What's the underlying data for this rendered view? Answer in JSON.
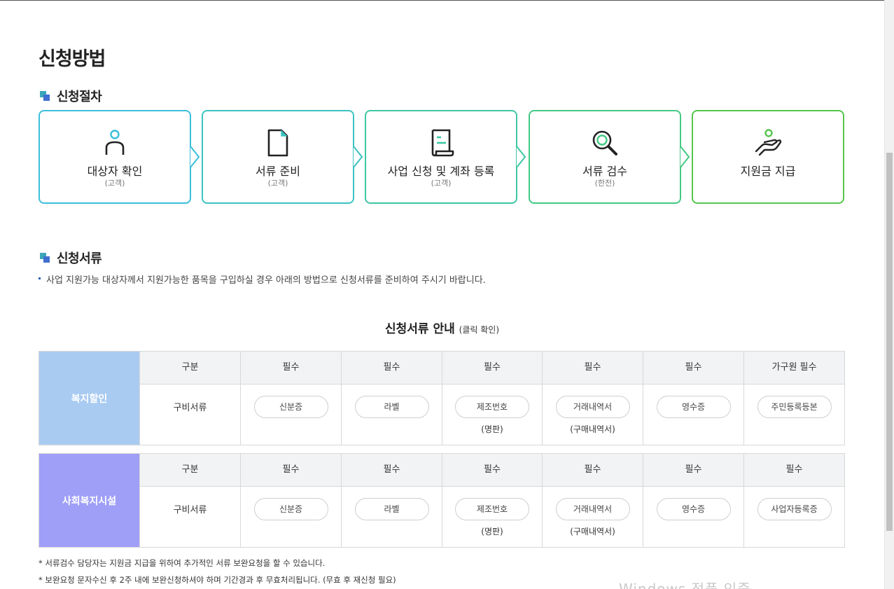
{
  "page": {
    "title": "신청방법"
  },
  "procedure": {
    "heading": "신청절차",
    "steps": [
      {
        "label": "대상자 확인",
        "sub": "(고객)",
        "icon": "person-icon",
        "color": "#3bbfdb"
      },
      {
        "label": "서류 준비",
        "sub": "(고객)",
        "icon": "document-icon",
        "color": "#3cc3c0"
      },
      {
        "label": "사업 신청 및 계좌 등록",
        "sub": "(고객)",
        "icon": "scroll-icon",
        "color": "#3ec7a3"
      },
      {
        "label": "서류 검수",
        "sub": "(한전)",
        "icon": "magnifier-icon",
        "color": "#43c983"
      },
      {
        "label": "지원금 지급",
        "sub": "",
        "icon": "hand-coin-icon",
        "color": "#55c54d"
      }
    ]
  },
  "documents": {
    "heading": "신청서류",
    "description": "사업 지원가능 대상자께서 지원가능한 품목을 구입하실 경우 아래의 방법으로 신청서류를 준비하여 주시기 바랍니다.",
    "table_title": "신청서류 안내",
    "table_title_note": "(클릭 확인)",
    "tables": [
      {
        "category": "복지할인",
        "category_color": "#a9cbf2",
        "headers": [
          "구분",
          "필수",
          "필수",
          "필수",
          "필수",
          "필수",
          "가구원 필수"
        ],
        "row_label": "구비서류",
        "items": [
          {
            "label": "신분증",
            "sub": ""
          },
          {
            "label": "라벨",
            "sub": ""
          },
          {
            "label": "제조번호",
            "sub": "(명판)"
          },
          {
            "label": "거래내역서",
            "sub": "(구매내역서)"
          },
          {
            "label": "영수증",
            "sub": ""
          },
          {
            "label": "주민등록등본",
            "sub": ""
          }
        ]
      },
      {
        "category": "사회복지시설",
        "category_color": "#9f9ff8",
        "headers": [
          "구분",
          "필수",
          "필수",
          "필수",
          "필수",
          "필수",
          "필수"
        ],
        "row_label": "구비서류",
        "items": [
          {
            "label": "신분증",
            "sub": ""
          },
          {
            "label": "라벨",
            "sub": ""
          },
          {
            "label": "제조번호",
            "sub": "(명판)"
          },
          {
            "label": "거래내역서",
            "sub": "(구매내역서)"
          },
          {
            "label": "영수증",
            "sub": ""
          },
          {
            "label": "사업자등록증",
            "sub": ""
          }
        ]
      }
    ],
    "notes": [
      "* 서류검수 담당자는 지원금 지급을 위하여 추가적인 서류 보완요청을 할 수 있습니다.",
      "* 보완요청 문자수신 후 2주 내에 보완신청하셔야 하며 기간경과 후 무효처리됩니다. (무효 후 재신청 필요)"
    ]
  },
  "watermark": "Windows 정품 인증"
}
